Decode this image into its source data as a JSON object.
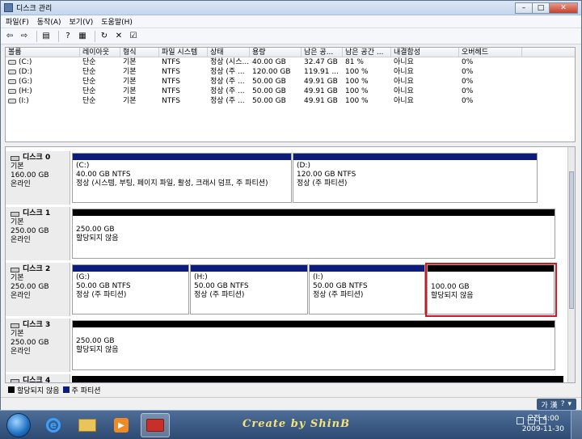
{
  "window": {
    "title": "디스크 관리"
  },
  "menu": [
    "파일(F)",
    "동작(A)",
    "보기(V)",
    "도움말(H)"
  ],
  "volumes": {
    "headers": [
      "볼륨",
      "레이아웃",
      "형식",
      "파일 시스템",
      "상태",
      "용량",
      "남은 공...",
      "남은 공간 ...",
      "내결함성",
      "오버헤드"
    ],
    "rows": [
      [
        "(C:)",
        "단순",
        "기본",
        "NTFS",
        "정상 (시스...",
        "40.00 GB",
        "32.47 GB",
        "81 %",
        "아니요",
        "0%"
      ],
      [
        "(D:)",
        "단순",
        "기본",
        "NTFS",
        "정상 (주 ...",
        "120.00 GB",
        "119.91 ...",
        "100 %",
        "아니요",
        "0%"
      ],
      [
        "(G:)",
        "단순",
        "기본",
        "NTFS",
        "정상 (주 ...",
        "50.00 GB",
        "49.91 GB",
        "100 %",
        "아니요",
        "0%"
      ],
      [
        "(H:)",
        "단순",
        "기본",
        "NTFS",
        "정상 (주 ...",
        "50.00 GB",
        "49.91 GB",
        "100 %",
        "아니요",
        "0%"
      ],
      [
        "(I:)",
        "단순",
        "기본",
        "NTFS",
        "정상 (주 ...",
        "50.00 GB",
        "49.91 GB",
        "100 %",
        "아니요",
        "0%"
      ]
    ]
  },
  "disks": [
    {
      "name": "디스크 0",
      "type": "기본",
      "size": "160.00 GB",
      "status": "온라인",
      "parts": [
        {
          "label": "(C:)",
          "info": "40.00 GB NTFS",
          "state": "정상 (시스템, 부팅, 페이지 파일, 활성, 크래시 덤프, 주 파티션)"
        },
        {
          "label": "(D:)",
          "info": "120.00 GB NTFS",
          "state": "정상 (주 파티션)"
        }
      ]
    },
    {
      "name": "디스크 1",
      "type": "기본",
      "size": "250.00 GB",
      "status": "온라인",
      "parts": [
        {
          "label": "",
          "info": "250.00 GB",
          "state": "할당되지 않음"
        }
      ]
    },
    {
      "name": "디스크 2",
      "type": "기본",
      "size": "250.00 GB",
      "status": "온라인",
      "parts": [
        {
          "label": "(G:)",
          "info": "50.00 GB NTFS",
          "state": "정상 (주 파티션)"
        },
        {
          "label": "(H:)",
          "info": "50.00 GB NTFS",
          "state": "정상 (주 파티션)"
        },
        {
          "label": "(I:)",
          "info": "50.00 GB NTFS",
          "state": "정상 (주 파티션)"
        },
        {
          "label": "",
          "info": "100.00 GB",
          "state": "할당되지 않음"
        }
      ]
    },
    {
      "name": "디스크 3",
      "type": "기본",
      "size": "250.00 GB",
      "status": "온라인",
      "parts": [
        {
          "label": "",
          "info": "250.00 GB",
          "state": "할당되지 않음"
        }
      ]
    },
    {
      "name": "디스크 4"
    }
  ],
  "legend": {
    "unallocated": "할당되지 않음",
    "primary": "주 파티션"
  },
  "colors": {
    "primary": "#0d1b7a",
    "unallocated": "#000000",
    "highlight": "#d3161f"
  },
  "langbar": {
    "label": "가 漢"
  },
  "taskbar": {
    "signature": "Create by ShinB",
    "time": "오전 4:00",
    "date": "2009-11-30"
  }
}
